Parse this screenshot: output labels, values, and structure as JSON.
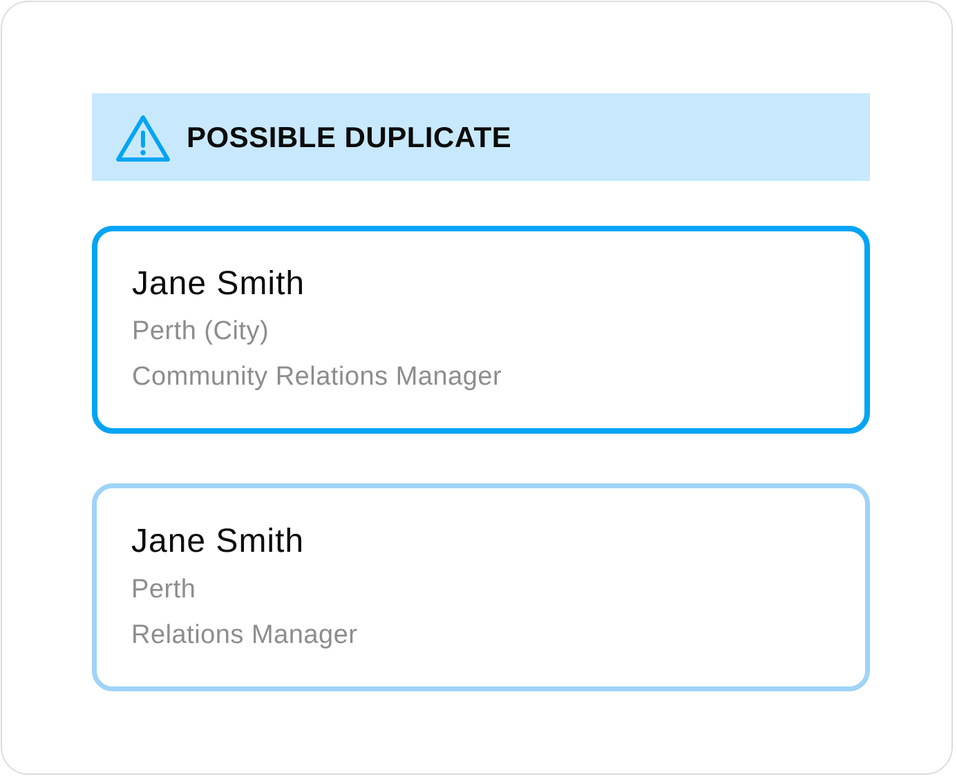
{
  "alert": {
    "title": "POSSIBLE DUPLICATE",
    "icon": "warning-triangle-icon",
    "accent_color": "#04a4f4",
    "background_color": "#c8e9fd"
  },
  "records": [
    {
      "name": "Jane Smith",
      "location": "Perth (City)",
      "role": "Community Relations Manager",
      "border_color": "#04a4f4"
    },
    {
      "name": "Jane Smith",
      "location": "Perth",
      "role": "Relations Manager",
      "border_color": "#9fd3f8"
    }
  ]
}
